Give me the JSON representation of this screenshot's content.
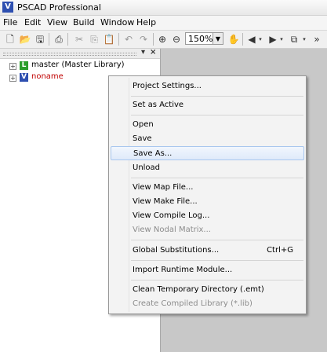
{
  "titlebar": {
    "title": "PSCAD Professional",
    "icon": "pscad-app-icon"
  },
  "menubar": [
    "File",
    "Edit",
    "View",
    "Build",
    "Window",
    "Help"
  ],
  "toolbar": {
    "zoom_value": "150%"
  },
  "workspace": {
    "items": [
      {
        "label": "master (Master Library)",
        "icon": "library-icon",
        "color": "#2a9d2a"
      },
      {
        "label": "noname",
        "icon": "project-icon",
        "color": "#2e4fb0",
        "label_color": "#c00000"
      }
    ]
  },
  "context_menu": {
    "items": [
      {
        "label": "Project Settings..."
      },
      {
        "label": "Set as Active"
      },
      {
        "label": "Open"
      },
      {
        "label": "Save"
      },
      {
        "label": "Save As..."
      },
      {
        "label": "Unload"
      },
      {
        "label": "View Map File..."
      },
      {
        "label": "View Make File..."
      },
      {
        "label": "View Compile Log..."
      },
      {
        "label": "View Nodal Matrix..."
      },
      {
        "label": "Global Substitutions...",
        "shortcut": "Ctrl+G"
      },
      {
        "label": "Import Runtime Module..."
      },
      {
        "label": "Clean Temporary Directory (.emt)"
      },
      {
        "label": "Create Compiled Library (*.lib)"
      }
    ]
  }
}
